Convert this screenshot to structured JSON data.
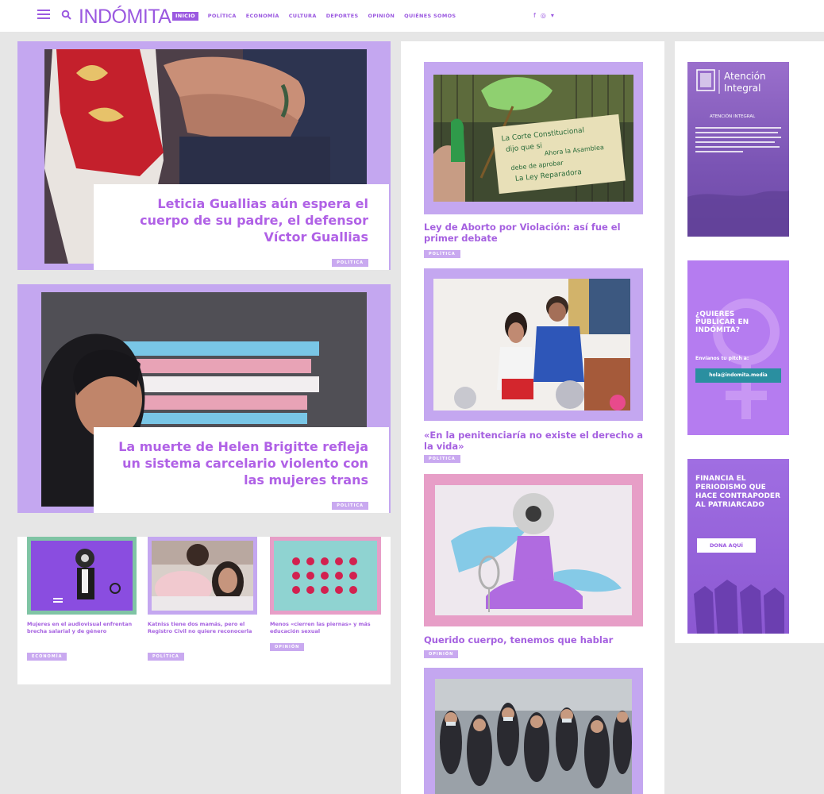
{
  "header": {
    "logo": "INDÓMITA",
    "nav": [
      "Inicio",
      "Política",
      "Economía",
      "Cultura",
      "Deportes",
      "Opinión",
      "Quiénes somos"
    ],
    "social": [
      "f",
      "◎",
      "▾"
    ]
  },
  "hero_stories": [
    {
      "title": "Leticia Guallias aún espera el cuerpo de su padre, el defensor Víctor Guallias",
      "tag": "Política"
    },
    {
      "title": "La muerte de Helen Brigitte refleja un sistema carcelario violento con las mujeres trans",
      "tag": "Política"
    }
  ],
  "small_stories": [
    {
      "title": "Mujeres en el audiovisual enfrentan brecha salarial y de género",
      "tag": "Economía"
    },
    {
      "title": "Katniss tiene dos mamás, pero el Registro Civil no quiere reconocerla",
      "tag": "Política"
    },
    {
      "title": "Menos «cierren las piernas» y más educación sexual",
      "tag": "Opinión"
    }
  ],
  "mid_stories": [
    {
      "title": "Ley de Aborto por Violación: así fue el primer debate",
      "tag": "Política"
    },
    {
      "title": "«En la penitenciaría no existe el derecho a la vida»",
      "tag": "Política"
    },
    {
      "title": "Querido cuerpo, tenemos que hablar",
      "tag": "Opinión"
    }
  ],
  "protest_sign": {
    "line1": "La Corte Constitucional",
    "line2": "dijo que si",
    "line3": "Ahora la Asamblea",
    "line4": "debe de aprobar",
    "line5": "La Ley Reparadora"
  },
  "ads": {
    "atencion": {
      "title_1": "Atención",
      "title_2": "Integral",
      "subtitle": "ATENCIÓN INTEGRAL"
    },
    "publicar": {
      "heading": "¿QUIERES PUBLICAR EN INDÓMITA?",
      "sub": "Envíanos tu pitch a:",
      "email": "hola@indomita.media"
    },
    "financia": {
      "heading": "FINANCIA EL PERIODISMO QUE HACE CONTRAPODER AL PATRIARCADO",
      "button": "DONA AQUÍ"
    }
  },
  "colors": {
    "brand": "#9b59e0",
    "title": "#b061e6",
    "frame": "#c4a7f0",
    "tag": "#c9a9f0"
  }
}
